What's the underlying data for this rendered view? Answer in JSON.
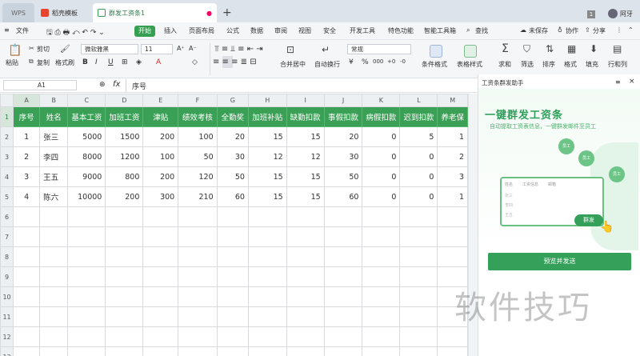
{
  "tabs": {
    "wps": "WPS",
    "template": "稻壳模板",
    "file": "群发工资条1",
    "add": "+"
  },
  "titlebar": {
    "badge": "1",
    "user": "阿牙"
  },
  "menu": {
    "items": [
      "文件",
      "开始",
      "插入",
      "页面布局",
      "公式",
      "数据",
      "审阅",
      "视图",
      "安全",
      "开发工具",
      "特色功能",
      "智能工具箱"
    ],
    "search": "查找",
    "unsaved": "未保存",
    "collab": "协作",
    "share": "分享"
  },
  "ribbon": {
    "paste": "粘贴",
    "cut": "剪切",
    "copy": "复制",
    "format_painter": "格式刷",
    "font": "微软雅黑",
    "size": "11",
    "merge": "合并居中",
    "wrap": "自动换行",
    "number_format": "常规",
    "cond": "条件格式",
    "table_style": "表格样式",
    "sum": "求和",
    "filter": "筛选",
    "sort": "排序",
    "format": "格式",
    "fill": "填充",
    "rowcol": "行和列",
    "bold": "B",
    "italic": "I",
    "underline": "U",
    "font_color_glyph": "A",
    "fill_glyph": "◇",
    "percent": "%",
    "thousands": "000",
    "dec_add": "+0",
    "dec_sub": "-0"
  },
  "formula": {
    "cell_ref": "A1",
    "fx": "fx",
    "value": "序号"
  },
  "sheet": {
    "columns": [
      "A",
      "B",
      "C",
      "D",
      "E",
      "F",
      "G",
      "H",
      "I",
      "J",
      "K",
      "L",
      "M"
    ],
    "row_numbers": [
      "1",
      "2",
      "3",
      "4",
      "5",
      "6",
      "7",
      "8",
      "9",
      "10",
      "11",
      "12",
      "13"
    ],
    "headers": [
      "序号",
      "姓名",
      "基本工资",
      "加班工资",
      "津贴",
      "绩效考核",
      "全勤奖",
      "加班补贴",
      "缺勤扣款",
      "事假扣款",
      "病假扣款",
      "迟到扣款",
      "养老保"
    ],
    "rows": [
      [
        "1",
        "张三",
        "5000",
        "1500",
        "200",
        "100",
        "20",
        "15",
        "15",
        "20",
        "0",
        "5",
        "1"
      ],
      [
        "2",
        "李四",
        "8000",
        "1200",
        "100",
        "50",
        "30",
        "12",
        "12",
        "30",
        "0",
        "0",
        "2"
      ],
      [
        "3",
        "王五",
        "9000",
        "800",
        "200",
        "120",
        "50",
        "15",
        "15",
        "50",
        "0",
        "0",
        "3"
      ],
      [
        "4",
        "陈六",
        "10000",
        "200",
        "300",
        "210",
        "60",
        "15",
        "15",
        "60",
        "0",
        "0",
        "1"
      ]
    ]
  },
  "panel": {
    "title": "工资条群发助手",
    "headline": "一键群发工资条",
    "subtitle": "自动提取工资表信息，一键群发邮件至员工",
    "send_label": "群发",
    "button": "预览并发送",
    "people": [
      "员工",
      "员工",
      "员工"
    ],
    "mock_headers": [
      "姓名",
      "工资信息",
      "邮箱"
    ],
    "mock_names": [
      "张三",
      "李四",
      "王五"
    ]
  },
  "watermark": "软件技巧",
  "colors": {
    "accent": "#36a052",
    "header_fill": "#3aa055",
    "selected": "#d6e6da"
  }
}
